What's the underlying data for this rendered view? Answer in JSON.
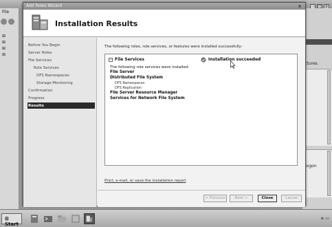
{
  "background": {
    "window_title": "File",
    "left_menu": [
      "File"
    ],
    "tree_items": [
      "⊞",
      "⊞",
      "⊞",
      "⊞"
    ],
    "right_text_1": "ttures.",
    "right_text_2": "logon"
  },
  "wizard": {
    "title": "Add Roles Wizard",
    "close_glyph": "x",
    "header_title": "Installation Results",
    "nav": [
      {
        "label": "Before You Begin",
        "level": 0
      },
      {
        "label": "Server Roles",
        "level": 0
      },
      {
        "label": "File Services",
        "level": 0
      },
      {
        "label": "Role Services",
        "level": 1
      },
      {
        "label": "DFS Namespaces",
        "level": 2
      },
      {
        "label": "Storage Monitoring",
        "level": 2
      },
      {
        "label": "Confirmation",
        "level": 0
      },
      {
        "label": "Progress",
        "level": 0
      },
      {
        "label": "Results",
        "level": 0,
        "active": true
      }
    ],
    "intro": "The following roles, role services, or features were installed successfully:",
    "result": {
      "collapse_glyph": "−",
      "role": "File Services",
      "status": "Installation succeeded",
      "details": [
        {
          "text": "The following role services were installed:",
          "style": "normal"
        },
        {
          "text": "File Server",
          "style": "bold"
        },
        {
          "text": "Distributed File System",
          "style": "bold"
        },
        {
          "text": "DFS Namespaces",
          "style": "indent"
        },
        {
          "text": "DFS Replication",
          "style": "indent"
        },
        {
          "text": "File Server Resource Manager",
          "style": "bold"
        },
        {
          "text": "Services for Network File System",
          "style": "bold"
        }
      ]
    },
    "report_link": "Print, e-mail, or save the installation report",
    "buttons": {
      "previous": "< Previous",
      "next": "Next >",
      "close": "Close",
      "cancel": "Cancel"
    }
  },
  "taskbar": {
    "start_label": "Start",
    "tray_text": "≥ ▭"
  }
}
